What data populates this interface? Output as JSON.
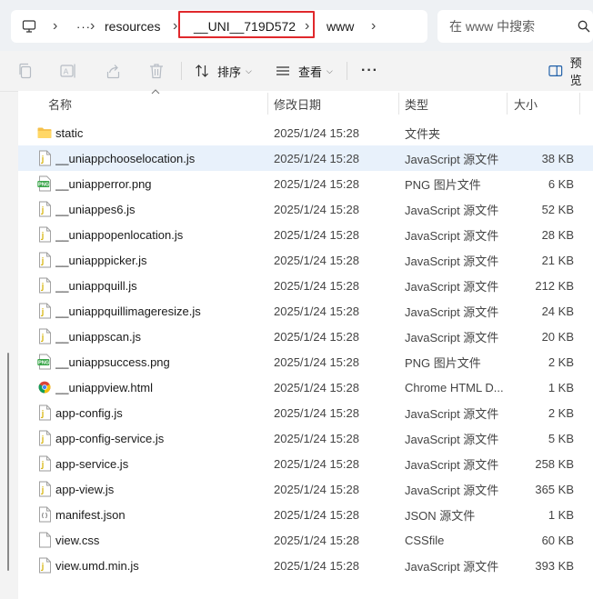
{
  "address": {
    "crumbs": [
      "resources",
      "__UNI__719D572",
      "www"
    ],
    "ellipsis": "···",
    "highlight_color": "#e0282c"
  },
  "search": {
    "placeholder": "在 www 中搜索"
  },
  "toolbar": {
    "sort_label": "排序",
    "view_label": "查看",
    "more_label": "···",
    "preview_label": "预览"
  },
  "columns": {
    "name": "名称",
    "date": "修改日期",
    "type": "类型",
    "size": "大小"
  },
  "files": [
    {
      "name": "static",
      "date": "2025/1/24 15:28",
      "type": "文件夹",
      "size": "",
      "icon": "folder-icon"
    },
    {
      "name": "__uniappchooselocation.js",
      "date": "2025/1/24 15:28",
      "type": "JavaScript 源文件",
      "size": "38 KB",
      "icon": "js-file-icon",
      "selected": true
    },
    {
      "name": "__uniapperror.png",
      "date": "2025/1/24 15:28",
      "type": "PNG 图片文件",
      "size": "6 KB",
      "icon": "png-file-icon"
    },
    {
      "name": "__uniappes6.js",
      "date": "2025/1/24 15:28",
      "type": "JavaScript 源文件",
      "size": "52 KB",
      "icon": "js-file-icon"
    },
    {
      "name": "__uniappopenlocation.js",
      "date": "2025/1/24 15:28",
      "type": "JavaScript 源文件",
      "size": "28 KB",
      "icon": "js-file-icon"
    },
    {
      "name": "__uniapppicker.js",
      "date": "2025/1/24 15:28",
      "type": "JavaScript 源文件",
      "size": "21 KB",
      "icon": "js-file-icon"
    },
    {
      "name": "__uniappquill.js",
      "date": "2025/1/24 15:28",
      "type": "JavaScript 源文件",
      "size": "212 KB",
      "icon": "js-file-icon"
    },
    {
      "name": "__uniappquillimageresize.js",
      "date": "2025/1/24 15:28",
      "type": "JavaScript 源文件",
      "size": "24 KB",
      "icon": "js-file-icon"
    },
    {
      "name": "__uniappscan.js",
      "date": "2025/1/24 15:28",
      "type": "JavaScript 源文件",
      "size": "20 KB",
      "icon": "js-file-icon"
    },
    {
      "name": "__uniappsuccess.png",
      "date": "2025/1/24 15:28",
      "type": "PNG 图片文件",
      "size": "2 KB",
      "icon": "png-file-icon"
    },
    {
      "name": "__uniappview.html",
      "date": "2025/1/24 15:28",
      "type": "Chrome HTML D...",
      "size": "1 KB",
      "icon": "chrome-html-icon"
    },
    {
      "name": "app-config.js",
      "date": "2025/1/24 15:28",
      "type": "JavaScript 源文件",
      "size": "2 KB",
      "icon": "js-file-icon"
    },
    {
      "name": "app-config-service.js",
      "date": "2025/1/24 15:28",
      "type": "JavaScript 源文件",
      "size": "5 KB",
      "icon": "js-file-icon"
    },
    {
      "name": "app-service.js",
      "date": "2025/1/24 15:28",
      "type": "JavaScript 源文件",
      "size": "258 KB",
      "icon": "js-file-icon"
    },
    {
      "name": "app-view.js",
      "date": "2025/1/24 15:28",
      "type": "JavaScript 源文件",
      "size": "365 KB",
      "icon": "js-file-icon"
    },
    {
      "name": "manifest.json",
      "date": "2025/1/24 15:28",
      "type": "JSON 源文件",
      "size": "1 KB",
      "icon": "json-file-icon"
    },
    {
      "name": "view.css",
      "date": "2025/1/24 15:28",
      "type": "CSSfile",
      "size": "60 KB",
      "icon": "css-file-icon"
    },
    {
      "name": "view.umd.min.js",
      "date": "2025/1/24 15:28",
      "type": "JavaScript 源文件",
      "size": "393 KB",
      "icon": "js-file-icon"
    }
  ]
}
